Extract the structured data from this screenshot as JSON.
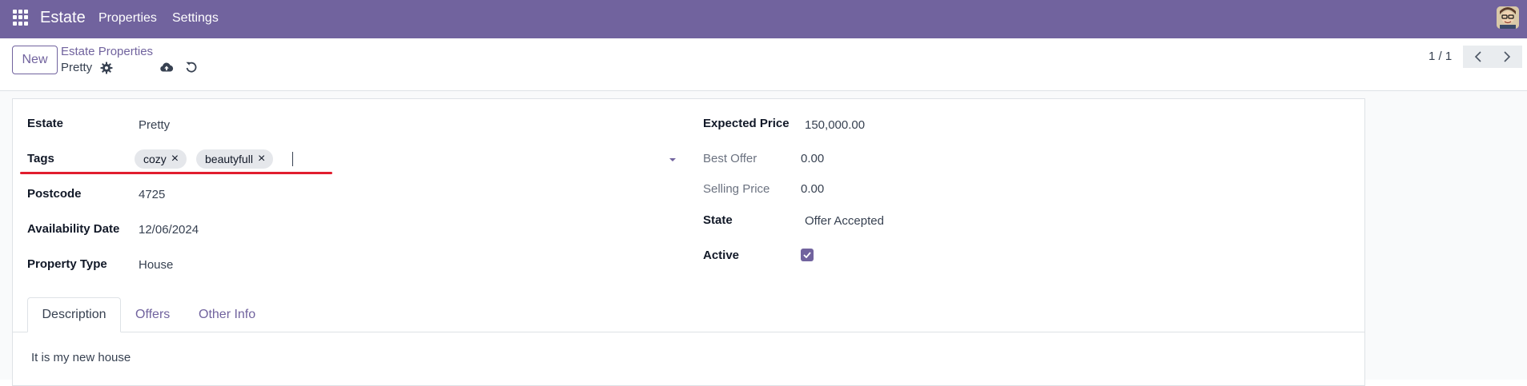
{
  "navbar": {
    "app_name": "Estate",
    "menu": [
      "Properties",
      "Settings"
    ],
    "bg_color": "#71639e"
  },
  "control_panel": {
    "new_button": "New",
    "breadcrumb_parent": "Estate Properties",
    "breadcrumb_current": "Pretty",
    "pager": "1 / 1"
  },
  "form": {
    "left": {
      "estate": {
        "label": "Estate",
        "value": "Pretty"
      },
      "tags": {
        "label": "Tags",
        "values": [
          "cozy",
          "beautyfull"
        ]
      },
      "postcode": {
        "label": "Postcode",
        "value": "4725"
      },
      "availability": {
        "label": "Availability Date",
        "value": "12/06/2024"
      },
      "property_type": {
        "label": "Property Type",
        "value": "House"
      }
    },
    "right": {
      "expected_price": {
        "label": "Expected Price",
        "value": "150,000.00"
      },
      "best_offer": {
        "label": "Best Offer",
        "value": "0.00"
      },
      "selling_price": {
        "label": "Selling Price",
        "value": "0.00"
      },
      "state": {
        "label": "State",
        "value": "Offer Accepted"
      },
      "active": {
        "label": "Active",
        "checked": true
      }
    }
  },
  "tabs": [
    "Description",
    "Offers",
    "Other Info"
  ],
  "description": "It is my new house",
  "annotation_color": "#e11d2e"
}
